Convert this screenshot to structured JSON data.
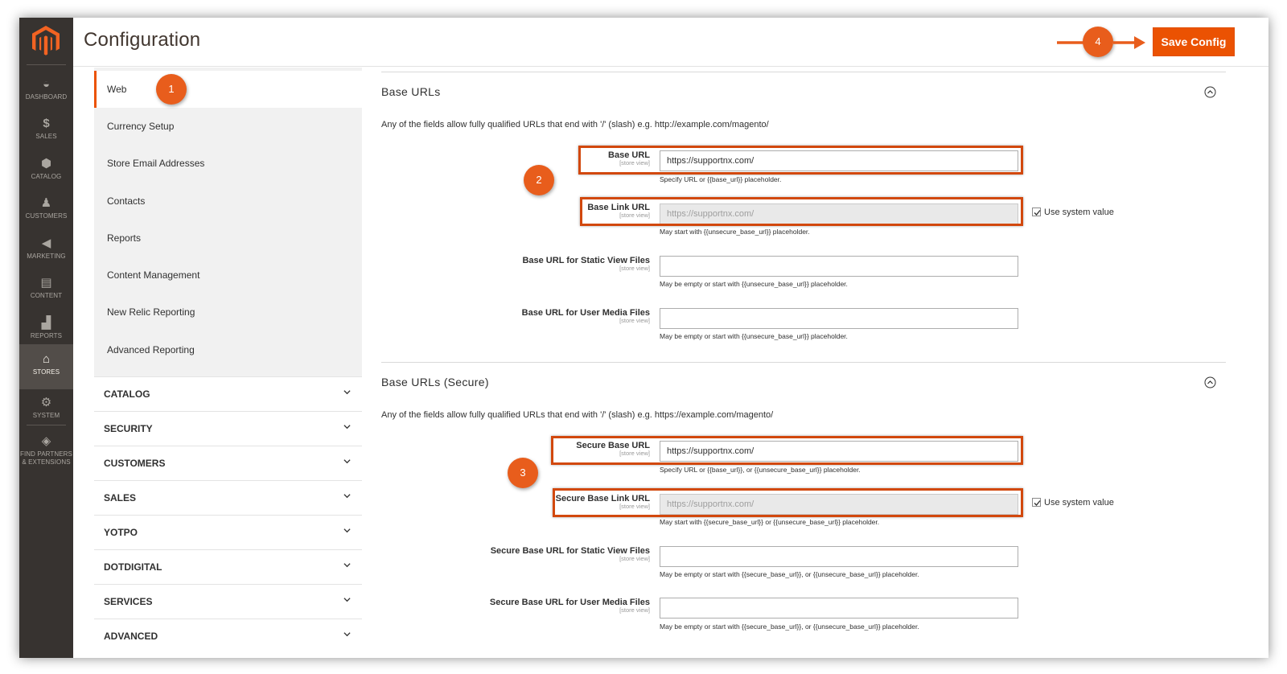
{
  "header": {
    "title": "Configuration",
    "save_label": "Save Config"
  },
  "admin_nav": {
    "items": [
      {
        "label": "DASHBOARD",
        "icon": "dashboard-icon"
      },
      {
        "label": "SALES",
        "icon": "dollar-icon"
      },
      {
        "label": "CATALOG",
        "icon": "cube-icon"
      },
      {
        "label": "CUSTOMERS",
        "icon": "person-icon"
      },
      {
        "label": "MARKETING",
        "icon": "megaphone-icon"
      },
      {
        "label": "CONTENT",
        "icon": "layout-icon"
      },
      {
        "label": "REPORTS",
        "icon": "bar-chart-icon"
      },
      {
        "label": "STORES",
        "icon": "store-icon",
        "active": true
      },
      {
        "label": "SYSTEM",
        "icon": "gear-icon"
      },
      {
        "label": "FIND PARTNERS",
        "label2": "& EXTENSIONS",
        "icon": "box-icon"
      }
    ]
  },
  "config_tabs": {
    "general_items": [
      {
        "label": "Web",
        "active": true
      },
      {
        "label": "Currency Setup"
      },
      {
        "label": "Store Email Addresses"
      },
      {
        "label": "Contacts"
      },
      {
        "label": "Reports"
      },
      {
        "label": "Content Management"
      },
      {
        "label": "New Relic Reporting"
      },
      {
        "label": "Advanced Reporting"
      }
    ],
    "sections": [
      "CATALOG",
      "SECURITY",
      "CUSTOMERS",
      "SALES",
      "YOTPO",
      "DOTDIGITAL",
      "SERVICES",
      "ADVANCED"
    ]
  },
  "base_urls": {
    "title": "Base URLs",
    "comment": "Any of the fields allow fully qualified URLs that end with '/' (slash) e.g. http://example.com/magento/",
    "fields": [
      {
        "label": "Base URL",
        "scope": "[store view]",
        "value": "https://supportnx.com/",
        "note": "Specify URL or {{base_url}} placeholder."
      },
      {
        "label": "Base Link URL",
        "scope": "[store view]",
        "value": "https://supportnx.com/",
        "note": "May start with {{unsecure_base_url}} placeholder.",
        "use_system_value": "Use system value"
      },
      {
        "label": "Base URL for Static View Files",
        "scope": "[store view]",
        "value": "",
        "note": "May be empty or start with {{unsecure_base_url}} placeholder."
      },
      {
        "label": "Base URL for User Media Files",
        "scope": "[store view]",
        "value": "",
        "note": "May be empty or start with {{unsecure_base_url}} placeholder."
      }
    ]
  },
  "secure_urls": {
    "title": "Base URLs (Secure)",
    "comment": "Any of the fields allow fully qualified URLs that end with '/' (slash) e.g. https://example.com/magento/",
    "fields": [
      {
        "label": "Secure Base URL",
        "scope": "[store view]",
        "value": "https://supportnx.com/",
        "note": "Specify URL or {{base_url}}, or {{unsecure_base_url}} placeholder."
      },
      {
        "label": "Secure Base Link URL",
        "scope": "[store view]",
        "value": "https://supportnx.com/",
        "note": "May start with {{secure_base_url}} or {{unsecure_base_url}} placeholder.",
        "use_system_value": "Use system value"
      },
      {
        "label": "Secure Base URL for Static View Files",
        "scope": "[store view]",
        "value": "",
        "note": "May be empty or start with {{secure_base_url}}, or {{unsecure_base_url}} placeholder."
      },
      {
        "label": "Secure Base URL for User Media Files",
        "scope": "[store view]",
        "value": "",
        "note": "May be empty or start with {{secure_base_url}}, or {{unsecure_base_url}} placeholder."
      }
    ]
  },
  "annotations": [
    "1",
    "2",
    "3",
    "4"
  ],
  "colors": {
    "accent": "#eb5202",
    "annotation": "#e85d1c",
    "nav_bg": "#373330"
  }
}
